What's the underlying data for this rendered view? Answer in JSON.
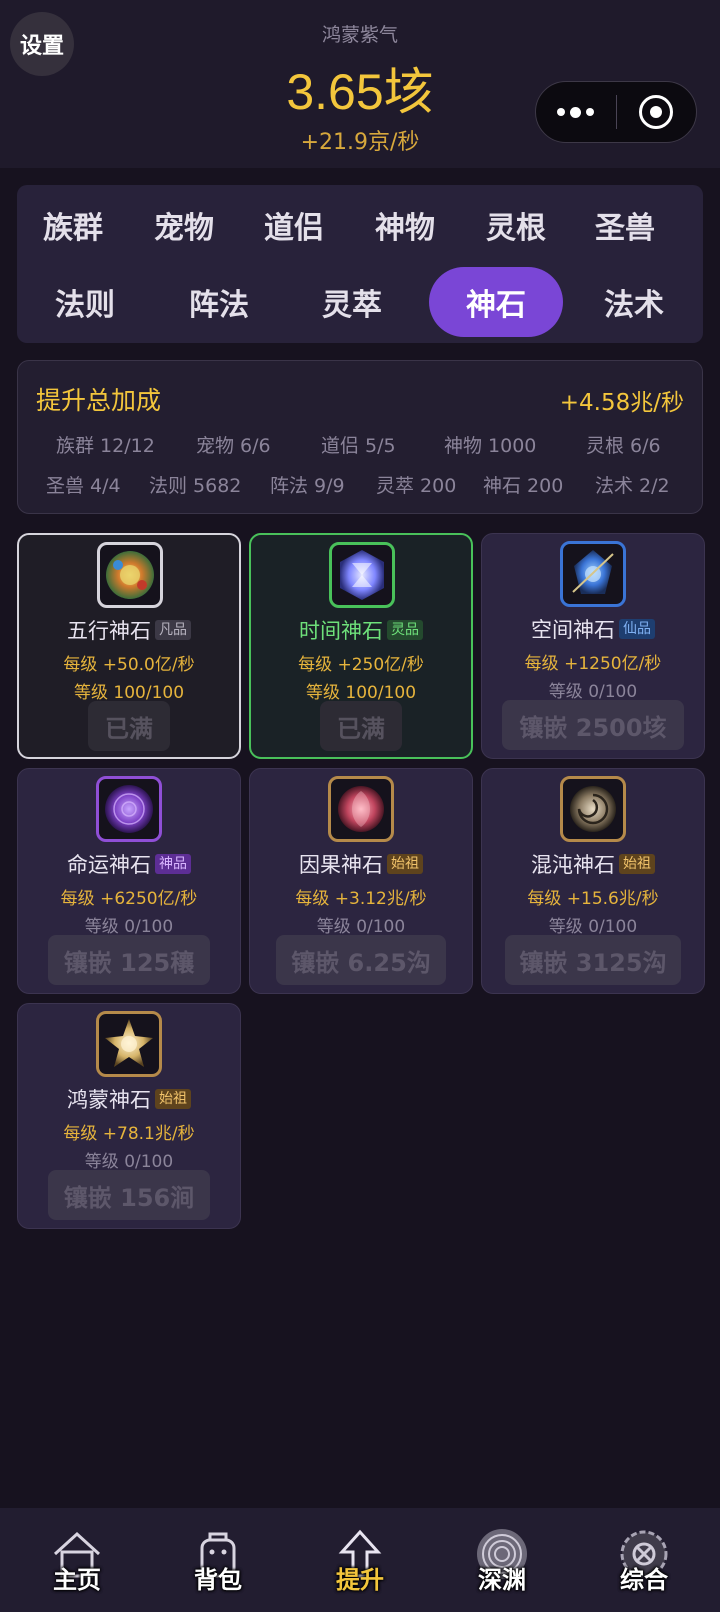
{
  "header": {
    "settings_label": "设置",
    "resource_name": "鸿蒙紫气",
    "resource_value": "3.65垓",
    "resource_rate": "+21.9京/秒"
  },
  "tabs": [
    {
      "label": "族群"
    },
    {
      "label": "宠物"
    },
    {
      "label": "道侣"
    },
    {
      "label": "神物"
    },
    {
      "label": "灵根"
    },
    {
      "label": "圣兽"
    },
    {
      "label": "法则"
    },
    {
      "label": "阵法"
    },
    {
      "label": "灵萃"
    },
    {
      "label": "神石",
      "active": true
    },
    {
      "label": "法术"
    }
  ],
  "bonus": {
    "title": "提升总加成",
    "total": "+4.58兆/秒",
    "items": [
      "族群 12/12",
      "宠物 6/6",
      "道侣 5/5",
      "神物 1000",
      "灵根 6/6",
      "圣兽 4/4",
      "法则 5682",
      "阵法 9/9",
      "灵萃 200",
      "神石 200",
      "法术 2/2"
    ]
  },
  "stones": [
    {
      "name": "五行神石",
      "tier": "凡品",
      "per_level": "每级 +50.0亿/秒",
      "level": "等级 100/100",
      "action": "已满",
      "icon": "wuxing-stone-icon",
      "color": "#c9a23a"
    },
    {
      "name": "时间神石",
      "tier": "灵品",
      "per_level": "每级 +250亿/秒",
      "level": "等级 100/100",
      "action": "已满",
      "icon": "time-stone-icon",
      "color": "#7f86ff"
    },
    {
      "name": "空间神石",
      "tier": "仙品",
      "per_level": "每级 +1250亿/秒",
      "level": "等级 0/100",
      "action": "镶嵌 2500垓",
      "icon": "space-stone-icon",
      "color": "#3a74d6"
    },
    {
      "name": "命运神石",
      "tier": "神品",
      "per_level": "每级 +6250亿/秒",
      "level": "等级 0/100",
      "action": "镶嵌 125穰",
      "icon": "fate-stone-icon",
      "color": "#7b3fc4"
    },
    {
      "name": "因果神石",
      "tier": "始祖",
      "per_level": "每级 +3.12兆/秒",
      "level": "等级 0/100",
      "action": "镶嵌 6.25沟",
      "icon": "karma-stone-icon",
      "color": "#c0455e"
    },
    {
      "name": "混沌神石",
      "tier": "始祖",
      "per_level": "每级 +15.6兆/秒",
      "level": "等级 0/100",
      "action": "镶嵌 3125沟",
      "icon": "chaos-stone-icon",
      "color": "#8a7a62"
    },
    {
      "name": "鸿蒙神石",
      "tier": "始祖",
      "per_level": "每级 +78.1兆/秒",
      "level": "等级 0/100",
      "action": "镶嵌 156涧",
      "icon": "hongmeng-stone-icon",
      "color": "#d6b469"
    }
  ],
  "nav": [
    {
      "label": "主页",
      "icon": "home-icon"
    },
    {
      "label": "背包",
      "icon": "backpack-icon"
    },
    {
      "label": "提升",
      "icon": "upgrade-arrow-icon",
      "active": true
    },
    {
      "label": "深渊",
      "icon": "abyss-vortex-icon"
    },
    {
      "label": "综合",
      "icon": "general-gear-icon"
    }
  ]
}
